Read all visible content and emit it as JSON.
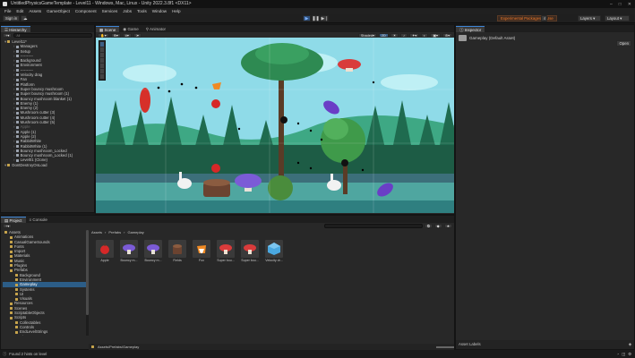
{
  "window": {
    "title": "UntitledPhysicsGameTemplate - Level11 - Windows, Mac, Linux - Unity 2022.3.8f1 <DX11>",
    "controls": [
      "minimize-icon",
      "maximize-icon",
      "close-icon"
    ]
  },
  "menu": [
    "File",
    "Edit",
    "Assets",
    "GameObject",
    "Component",
    "Services",
    "Jobs",
    "Tools",
    "Window",
    "Help"
  ],
  "toolbar": {
    "sign_in": "Sign in",
    "notice": "Experimental Packages In Use",
    "layers": "Layers",
    "layout": "Layout"
  },
  "hierarchy": {
    "tab": "Hierarchy",
    "search_placeholder": "All",
    "items": [
      {
        "label": "Level11*",
        "depth": 0,
        "kind": "scene"
      },
      {
        "label": "Managers",
        "depth": 1
      },
      {
        "label": "Setup",
        "depth": 1
      },
      {
        "label": "----------",
        "depth": 1
      },
      {
        "label": "Background",
        "depth": 1
      },
      {
        "label": "Environment",
        "depth": 1
      },
      {
        "label": "----------",
        "depth": 1
      },
      {
        "label": "Velocity drag",
        "depth": 1
      },
      {
        "label": "Fan",
        "depth": 1
      },
      {
        "label": "Platform",
        "depth": 1
      },
      {
        "label": "Super bouncy mushroom",
        "depth": 1
      },
      {
        "label": "Super bouncy mushroom (1)",
        "depth": 1
      },
      {
        "label": "Bouncy mushroom blanket (1)",
        "depth": 1
      },
      {
        "label": "Enemy (1)",
        "depth": 1
      },
      {
        "label": "Enemy (2)",
        "depth": 1
      },
      {
        "label": "Mushroom cutter (3)",
        "depth": 1
      },
      {
        "label": "Mushroom cutter (4)",
        "depth": 1
      },
      {
        "label": "Mushroom cutter (5)",
        "depth": 1
      },
      {
        "label": "Apple",
        "depth": 1,
        "disabled": true
      },
      {
        "label": "Apple (1)",
        "depth": 1
      },
      {
        "label": "Apple (2)",
        "depth": 1
      },
      {
        "label": "RabbitWhite",
        "depth": 1
      },
      {
        "label": "RabbitWhite (1)",
        "depth": 1
      },
      {
        "label": "Bouncy mushroom_Locked",
        "depth": 1
      },
      {
        "label": "Bouncy mushroom_Locked (1)",
        "depth": 1
      },
      {
        "label": "Level01 (Clone)",
        "depth": 1
      },
      {
        "label": "DontDestroyOnLoad",
        "depth": 0,
        "kind": "scene"
      }
    ]
  },
  "scene_view": {
    "tabs": [
      "Scene",
      "Game",
      "Animator"
    ],
    "active_tab": "Scene",
    "shading": "Shaded",
    "mode": "2D"
  },
  "project": {
    "tabs": [
      "Project",
      "Console"
    ],
    "breadcrumb": [
      "Assets",
      "Prefabs",
      "Gameplay"
    ],
    "tree": [
      {
        "label": "Assets",
        "depth": 0
      },
      {
        "label": "Animations",
        "depth": 1
      },
      {
        "label": "CasualGameSounds",
        "depth": 1
      },
      {
        "label": "Fonts",
        "depth": 1
      },
      {
        "label": "Import",
        "depth": 1
      },
      {
        "label": "Materials",
        "depth": 1
      },
      {
        "label": "Music",
        "depth": 1
      },
      {
        "label": "Plugins",
        "depth": 1
      },
      {
        "label": "Prefabs",
        "depth": 1
      },
      {
        "label": "Background",
        "depth": 2
      },
      {
        "label": "Environment",
        "depth": 2
      },
      {
        "label": "Gameplay",
        "depth": 2,
        "selected": true
      },
      {
        "label": "Systems",
        "depth": 2
      },
      {
        "label": "UI",
        "depth": 2
      },
      {
        "label": "Visuals",
        "depth": 2
      },
      {
        "label": "Resources",
        "depth": 1
      },
      {
        "label": "Scenes",
        "depth": 1
      },
      {
        "label": "ScriptableObjects",
        "depth": 1
      },
      {
        "label": "Scripts",
        "depth": 1
      },
      {
        "label": "Collectables",
        "depth": 2
      },
      {
        "label": "Controls",
        "depth": 2
      },
      {
        "label": "EndLevelStrings",
        "depth": 2
      },
      {
        "label": "Hints",
        "depth": 2
      }
    ],
    "assets": [
      {
        "label": "Apple",
        "icon": "apple-icon"
      },
      {
        "label": "Bouncy m...",
        "icon": "mushroom-icon"
      },
      {
        "label": "Bouncy m...",
        "icon": "mushroom-icon"
      },
      {
        "label": "Fields",
        "icon": "stump-icon"
      },
      {
        "label": "Fox",
        "icon": "fox-icon"
      },
      {
        "label": "Super bou...",
        "icon": "mushroom-red-icon"
      },
      {
        "label": "Super bou...",
        "icon": "mushroom-red-icon"
      },
      {
        "label": "Velocity dr...",
        "icon": "prefab-cube-icon"
      }
    ],
    "path": "Assets/Prefabs/Gameplay"
  },
  "inspector": {
    "tab": "Inspector",
    "object": "Gameplay (Default Asset)",
    "open_button": "Open",
    "footer": "Asset Labels"
  },
  "status": "Found 2 hints on level",
  "colors": {
    "accent": "#3d85d6",
    "notice": "#f07a2a",
    "panel": "#282828"
  }
}
